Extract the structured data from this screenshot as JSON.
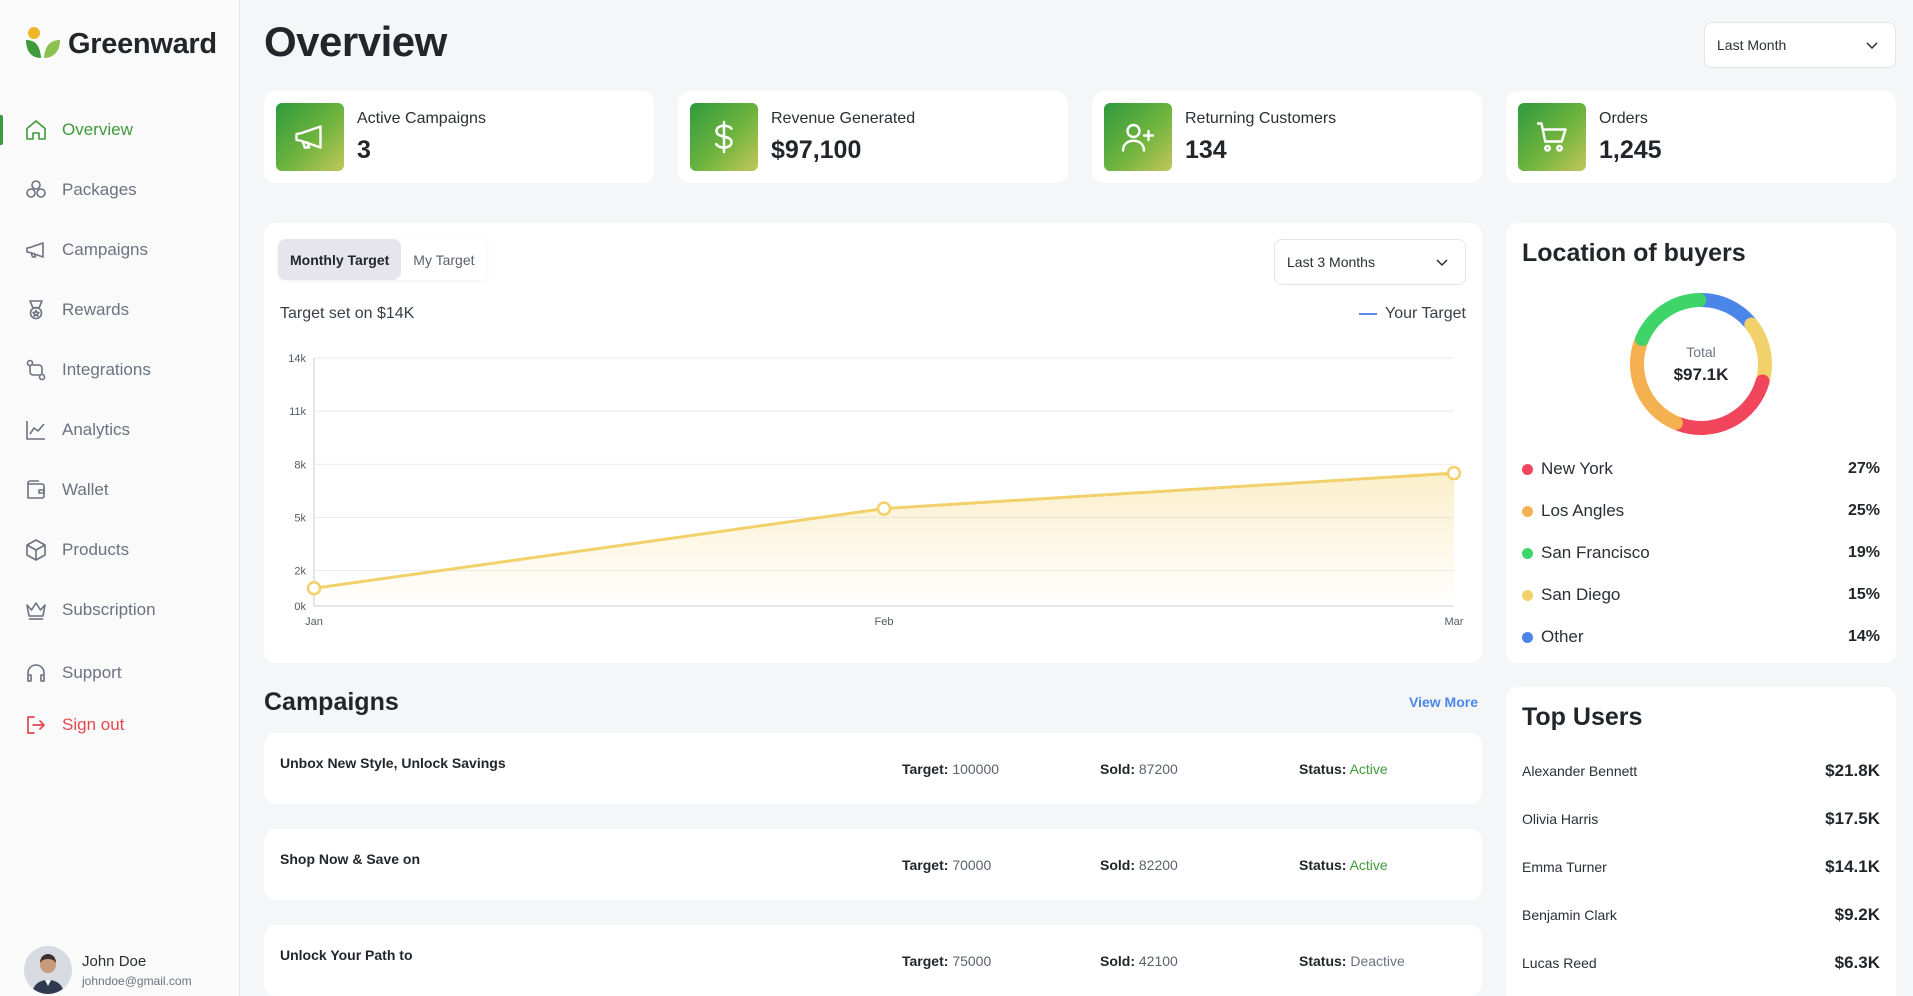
{
  "brand": {
    "name": "Greenward"
  },
  "sidebar": {
    "items": [
      {
        "label": "Overview",
        "icon": "home-icon",
        "active": true
      },
      {
        "label": "Packages",
        "icon": "packages-icon"
      },
      {
        "label": "Campaigns",
        "icon": "megaphone-icon"
      },
      {
        "label": "Rewards",
        "icon": "medal-icon"
      },
      {
        "label": "Integrations",
        "icon": "integrations-icon"
      },
      {
        "label": "Analytics",
        "icon": "analytics-icon"
      },
      {
        "label": "Wallet",
        "icon": "wallet-icon"
      },
      {
        "label": "Products",
        "icon": "box-icon"
      },
      {
        "label": "Subscription",
        "icon": "crown-icon"
      }
    ],
    "support_label": "Support",
    "signout_label": "Sign out"
  },
  "user": {
    "name": "John Doe",
    "email": "johndoe@gmail.com"
  },
  "header": {
    "title": "Overview",
    "period": "Last Month"
  },
  "stats": [
    {
      "label": "Active Campaigns",
      "value": "3",
      "icon": "megaphone-icon"
    },
    {
      "label": "Revenue Generated",
      "value": "$97,100",
      "icon": "dollar-icon"
    },
    {
      "label": "Returning Customers",
      "value": "134",
      "icon": "user-plus-icon"
    },
    {
      "label": "Orders",
      "value": "1,245",
      "icon": "cart-icon"
    }
  ],
  "target": {
    "tabs": [
      "Monthly Target",
      "My Target"
    ],
    "range": "Last 3 Months",
    "note": "Target set on $14K",
    "legend": "Your Target"
  },
  "chart_data": {
    "type": "area",
    "x": [
      "Jan",
      "Feb",
      "Mar"
    ],
    "series": [
      {
        "name": "Your Target",
        "values": [
          1,
          5.5,
          7.5
        ]
      }
    ],
    "ylim": [
      0,
      14
    ],
    "yticks": [
      0,
      2,
      5,
      8,
      11,
      14
    ],
    "ytick_labels": [
      "0k",
      "2k",
      "5k",
      "8k",
      "11k",
      "14k"
    ],
    "grid": true,
    "legend_position": "top-right",
    "color": "#f2d16b"
  },
  "location": {
    "title": "Location of buyers",
    "total_label": "Total",
    "total_value": "$97.1K",
    "items": [
      {
        "name": "New York",
        "pct": "27%",
        "value": 27,
        "color": "#f0455a"
      },
      {
        "name": "Los Angles",
        "pct": "25%",
        "value": 25,
        "color": "#f5b14f"
      },
      {
        "name": "San Francisco",
        "pct": "19%",
        "value": 19,
        "color": "#3fd46a"
      },
      {
        "name": "San Diego",
        "pct": "15%",
        "value": 15,
        "color": "#f2d16b"
      },
      {
        "name": "Other",
        "pct": "14%",
        "value": 14,
        "color": "#4a86e8"
      }
    ]
  },
  "campaigns": {
    "title": "Campaigns",
    "view_more": "View More",
    "target_label": "Target:",
    "sold_label": "Sold:",
    "status_label": "Status:",
    "rows": [
      {
        "name": "Unbox New Style, Unlock Savings",
        "target": "100000",
        "sold": "87200",
        "status": "Active"
      },
      {
        "name": "Shop Now & Save on",
        "target": "70000",
        "sold": "82200",
        "status": "Active"
      },
      {
        "name": "Unlock Your Path to",
        "target": "75000",
        "sold": "42100",
        "status": "Deactive"
      }
    ]
  },
  "top_users": {
    "title": "Top Users",
    "rows": [
      {
        "name": "Alexander Bennett",
        "amount": "$21.8K"
      },
      {
        "name": "Olivia Harris",
        "amount": "$17.5K"
      },
      {
        "name": "Emma Turner",
        "amount": "$14.1K"
      },
      {
        "name": "Benjamin Clark",
        "amount": "$9.2K"
      },
      {
        "name": "Lucas Reed",
        "amount": "$6.3K"
      }
    ]
  }
}
